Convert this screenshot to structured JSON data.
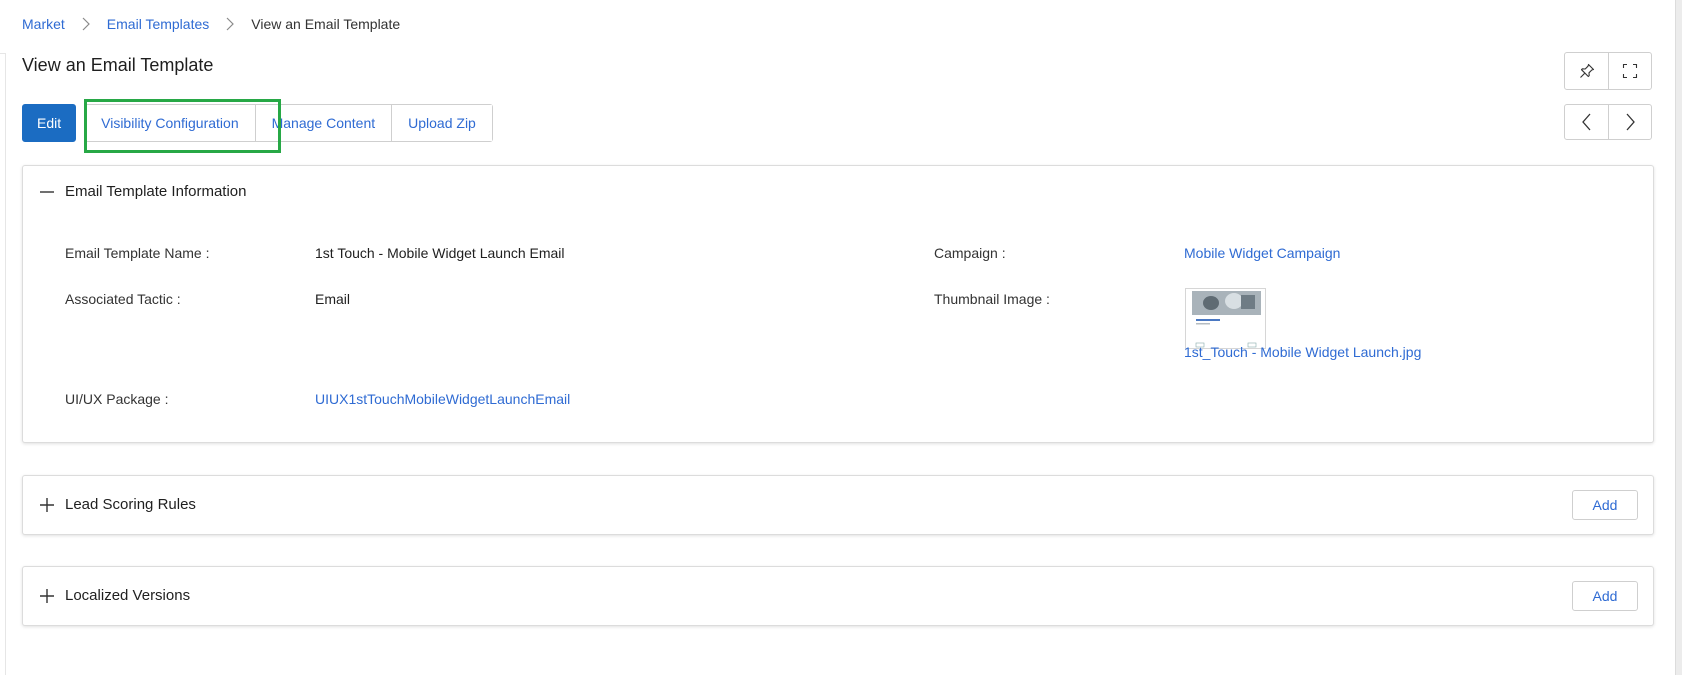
{
  "breadcrumb": {
    "items": [
      "Market",
      "Email Templates"
    ],
    "current": "View an Email Template"
  },
  "page": {
    "title": "View an Email Template"
  },
  "toolbar": {
    "edit_label": "Edit",
    "visibility_label": "Visibility Configuration",
    "manage_label": "Manage Content",
    "upload_label": "Upload Zip"
  },
  "info_panel": {
    "title": "Email Template Information",
    "fields": {
      "name_label": "Email Template Name :",
      "name_value": "1st Touch - Mobile Widget Launch Email",
      "tactic_label": "Associated Tactic :",
      "tactic_value": "Email",
      "package_label": "UI/UX Package :",
      "package_value": "UIUX1stTouchMobileWidgetLaunchEmail",
      "campaign_label": "Campaign :",
      "campaign_value": "Mobile Widget Campaign",
      "thumbnail_label": "Thumbnail Image :",
      "thumbnail_file": "1st_Touch - Mobile Widget Launch.jpg"
    }
  },
  "lead_panel": {
    "title": "Lead Scoring Rules",
    "add_label": "Add"
  },
  "local_panel": {
    "title": "Localized Versions",
    "add_label": "Add"
  },
  "colors": {
    "primary": "#1b6cc2",
    "link": "#2f6bd3",
    "highlight": "#27a846"
  },
  "icons": [
    "chevron-right-icon",
    "pin-icon",
    "fullscreen-icon",
    "chevron-left-icon",
    "minus-icon",
    "plus-icon"
  ]
}
